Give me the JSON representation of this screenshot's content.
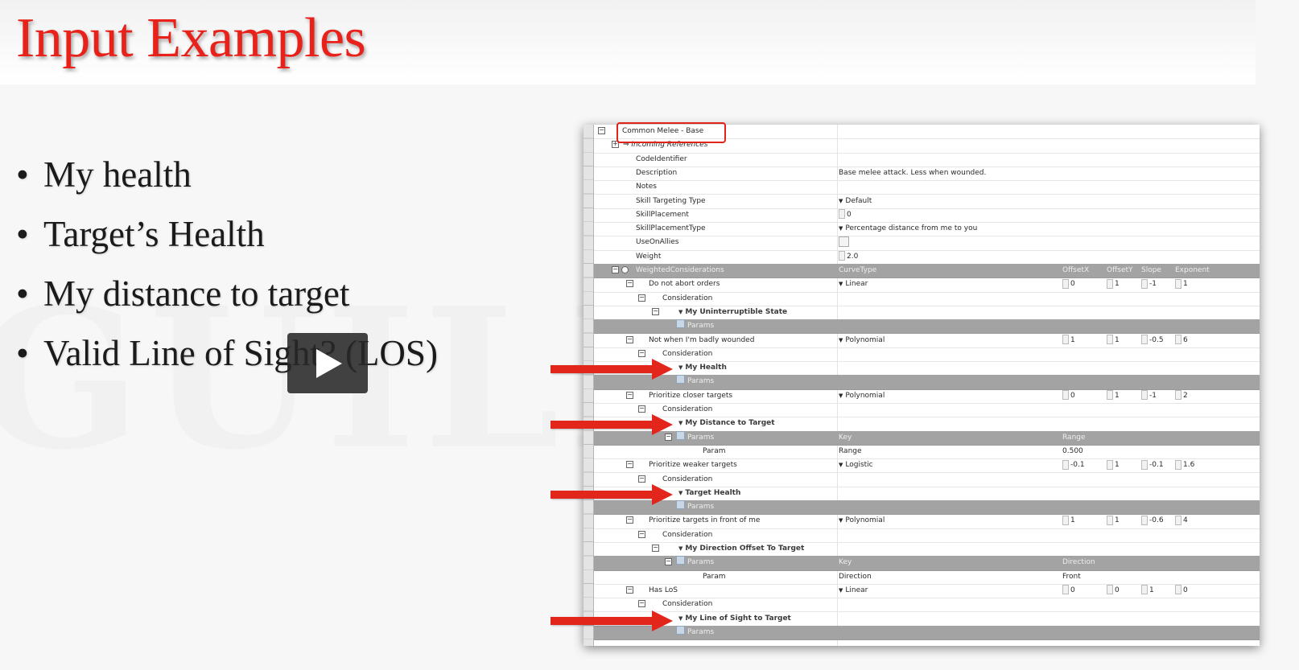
{
  "slide": {
    "title": "Input Examples",
    "bullets": [
      "My health",
      "Target’s Health",
      "My distance to target",
      "Valid Line of Sight? (LOS)"
    ],
    "bullet_glyph": "•",
    "colors": {
      "title": "#e8221b",
      "arrow": "#e3261b",
      "bullet_text": "#1b1b1b"
    }
  },
  "video": {
    "play_icon": "play-icon"
  },
  "editor": {
    "root_label": "Common Melee - Base",
    "incoming_refs": "Incoming References",
    "properties": [
      {
        "label": "CodeIdentifier",
        "value": ""
      },
      {
        "label": "Description",
        "value": "Base melee attack. Less when wounded."
      },
      {
        "label": "Notes",
        "value": ""
      },
      {
        "label": "Skill Targeting Type",
        "value": "Default"
      },
      {
        "label": "SkillPlacement",
        "value": "0"
      },
      {
        "label": "SkillPlacementType",
        "value": "Percentage distance from me to you"
      },
      {
        "label": "UseOnAllies",
        "value": ""
      },
      {
        "label": "Weight",
        "value": "2.0"
      }
    ],
    "weighted_header": {
      "label": "WeightedConsiderations",
      "curve_col": "CurveType",
      "cols": [
        "OffsetX",
        "OffsetY",
        "Slope",
        "Exponent"
      ]
    },
    "consideration_label": "Consideration",
    "params_label": "Params",
    "key_label": "Key",
    "param_label": "Param",
    "considerations": [
      {
        "name": "Do not abort orders",
        "curve": "Linear",
        "vals": [
          "0",
          "1",
          "-1",
          "1"
        ],
        "input": "My Uninterruptible State"
      },
      {
        "name": "Not when I'm badly wounded",
        "curve": "Polynomial",
        "vals": [
          "1",
          "1",
          "-0.5",
          "6"
        ],
        "input": "My Health"
      },
      {
        "name": "Prioritize closer targets",
        "curve": "Polynomial",
        "vals": [
          "0",
          "1",
          "-1",
          "2"
        ],
        "input": "My Distance to Target",
        "param": {
          "key": "Range",
          "value": "0.500"
        }
      },
      {
        "name": "Prioritize weaker targets",
        "curve": "Logistic",
        "vals": [
          "-0.1",
          "1",
          "-0.1",
          "1.6"
        ],
        "input": "Target Health"
      },
      {
        "name": "Prioritize targets in front of me",
        "curve": "Polynomial",
        "vals": [
          "1",
          "1",
          "-0.6",
          "4"
        ],
        "input": "My Direction Offset To Target",
        "param": {
          "key": "Direction",
          "value": "Front"
        }
      },
      {
        "name": "Has LoS",
        "curve": "Linear",
        "vals": [
          "0",
          "0",
          "1",
          "0"
        ],
        "input": "My Line of Sight to Target"
      }
    ]
  }
}
